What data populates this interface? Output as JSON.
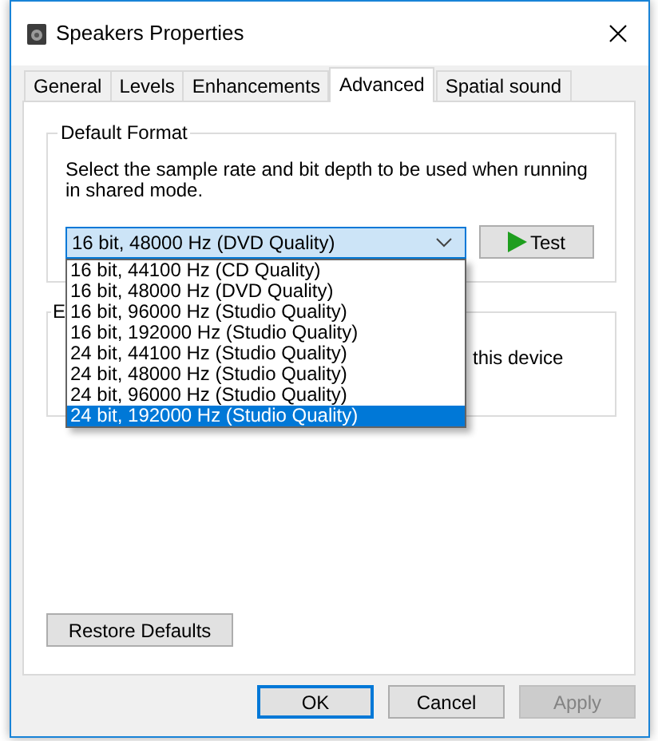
{
  "window": {
    "title": "Speakers Properties"
  },
  "tabs": [
    {
      "label": "General",
      "selected": false
    },
    {
      "label": "Levels",
      "selected": false
    },
    {
      "label": "Enhancements",
      "selected": false
    },
    {
      "label": "Advanced",
      "selected": true
    },
    {
      "label": "Spatial sound",
      "selected": false
    }
  ],
  "default_format": {
    "title": "Default Format",
    "description": "Select the sample rate and bit depth to be used when running in shared mode.",
    "format_select": {
      "value": "16 bit, 48000 Hz (DVD Quality)",
      "expanded": true
    },
    "test_button": "Test",
    "options": [
      {
        "label": "16 bit, 44100 Hz (CD Quality)",
        "selected": false
      },
      {
        "label": "16 bit, 48000 Hz (DVD Quality)",
        "selected": false
      },
      {
        "label": "16 bit, 96000 Hz (Studio Quality)",
        "selected": false
      },
      {
        "label": "16 bit, 192000 Hz (Studio Quality)",
        "selected": false
      },
      {
        "label": "24 bit, 44100 Hz (Studio Quality)",
        "selected": false
      },
      {
        "label": "24 bit, 48000 Hz (Studio Quality)",
        "selected": false
      },
      {
        "label": "24 bit, 96000 Hz (Studio Quality)",
        "selected": false
      },
      {
        "label": "24 bit, 192000 Hz (Studio Quality)",
        "selected": true
      }
    ]
  },
  "exclusive_group": {
    "title": "E",
    "text": "this device"
  },
  "restore_button": "Restore Defaults",
  "buttons": [
    {
      "label": "OK",
      "default": true,
      "disabled": false
    },
    {
      "label": "Cancel",
      "default": false,
      "disabled": false
    },
    {
      "label": "Apply",
      "default": false,
      "disabled": true
    }
  ]
}
